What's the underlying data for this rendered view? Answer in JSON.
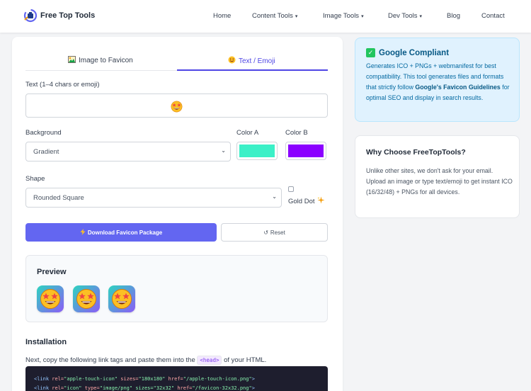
{
  "header": {
    "brand": "Free Top Tools",
    "nav": [
      {
        "label": "Home",
        "dropdown": false
      },
      {
        "label": "Content Tools",
        "dropdown": true
      },
      {
        "label": "Image Tools",
        "dropdown": true
      },
      {
        "label": "Dev Tools",
        "dropdown": true
      },
      {
        "label": "Blog",
        "dropdown": false
      },
      {
        "label": "Contact",
        "dropdown": false
      }
    ],
    "caret": "▾"
  },
  "tabs": [
    {
      "label": "Image to Favicon",
      "icon": "image-icon",
      "active": false
    },
    {
      "label": "Text / Emoji",
      "icon": "emoji-icon",
      "active": true
    }
  ],
  "form": {
    "text_label": "Text (1–4 chars or emoji)",
    "text_value_icon": "star-struck-emoji",
    "background_label": "Background",
    "background_value": "Gradient",
    "color_a_label": "Color A",
    "color_a": "#3bf0c7",
    "color_b_label": "Color B",
    "color_b": "#8b00ff",
    "shape_label": "Shape",
    "shape_value": "Rounded Square",
    "gold_dot_label": "Gold Dot",
    "gold_dot_checked": false,
    "chevron": "⌄"
  },
  "buttons": {
    "download": "Download Favicon Package",
    "reset": "Reset",
    "reset_glyph": "↺"
  },
  "preview": {
    "title": "Preview",
    "icon_count": 3
  },
  "installation": {
    "title": "Installation",
    "text_before": "Next, copy the following link tags and paste them into the ",
    "code_tag": "<head>",
    "text_after": " of your HTML.",
    "code_lines": [
      {
        "open": "<link",
        "rel_attr": " rel=",
        "rel": "\"apple-touch-icon\"",
        "extra_attr": " sizes=",
        "extra": "\"180x180\"",
        "href_attr": " href=",
        "href": "\"/apple-touch-icon.png\"",
        "close": ">"
      },
      {
        "open": "<link",
        "rel_attr": " rel=",
        "rel": "\"icon\"",
        "extra_attr": " type=",
        "extra": "\"image/png\" sizes=\"32x32\"",
        "href_attr": " href=",
        "href": "\"/favicon-32x32.png\"",
        "close": ">"
      }
    ]
  },
  "sidebar": {
    "compliant": {
      "title": "Google Compliant",
      "body_1": "Generates ICO + PNGs + webmanifest for best compatibility. This tool generates files and formats that strictly follow ",
      "body_bold": "Google's Favicon Guidelines",
      "body_2": " for optimal SEO and display in search results."
    },
    "why": {
      "title": "Why Choose FreeTopTools?",
      "body": "Unlike other sites, we don't ask for your email. Upload an image or type text/emoji to get instant ICO (16/32/48) + PNGs for all devices."
    }
  },
  "colors": {
    "accent": "#6366f1",
    "tab_active": "#4f46e5"
  }
}
